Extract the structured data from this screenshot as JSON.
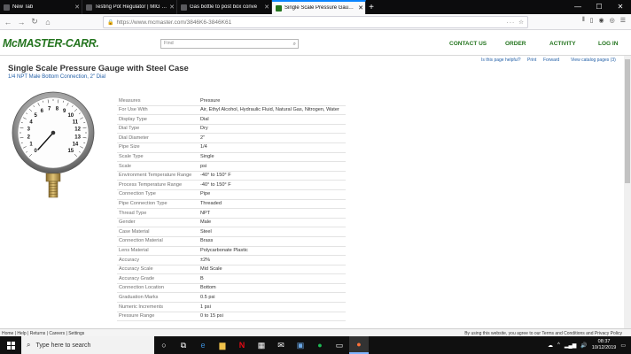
{
  "browser": {
    "tabs": [
      {
        "label": "New Tab",
        "active": false
      },
      {
        "label": "Testing Pot Regulator | MIG We",
        "active": false
      },
      {
        "label": "Gas bottle to post box conve",
        "active": false
      },
      {
        "label": "Single Scale Pressure Gauge w",
        "active": true
      }
    ],
    "url": "https://www.mcmaster.com/3846K6-3846K61"
  },
  "site": {
    "logo": "McMASTER-CARR.",
    "search_placeholder": "Find",
    "nav": [
      "CONTACT US",
      "ORDER",
      "ACTIVITY",
      "LOG IN"
    ],
    "subnav": {
      "helpful": "Is this page helpful?",
      "print": "Print",
      "forward": "Forward",
      "catalog": "View catalog pages (3)"
    }
  },
  "product": {
    "title": "Single Scale Pressure Gauge with Steel Case",
    "subtitle": "1/4 NPT Male Bottom Connection, 2\" Dial",
    "specs": [
      {
        "k": "Measures",
        "v": "Pressure"
      },
      {
        "k": "For Use With",
        "v": "Air, Ethyl Alcohol, Hydraulic Fluid, Natural Gas, Nitrogen, Water"
      },
      {
        "k": "Display Type",
        "v": "Dial"
      },
      {
        "k": "Dial Type",
        "v": "Dry"
      },
      {
        "k": "Dial Diameter",
        "v": "2\""
      },
      {
        "k": "Pipe Size",
        "v": "1/4"
      },
      {
        "k": "Scale Type",
        "v": "Single"
      },
      {
        "k": "Scale",
        "v": "psi"
      },
      {
        "k": "Environment Temperature Range",
        "v": "-40° to 150° F"
      },
      {
        "k": "Process Temperature Range",
        "v": "-40° to 150° F"
      },
      {
        "k": "Connection Type",
        "v": "Pipe"
      },
      {
        "k": "Pipe Connection Type",
        "v": "Threaded"
      },
      {
        "k": "Thread Type",
        "v": "NPT"
      },
      {
        "k": "Gender",
        "v": "Male"
      },
      {
        "k": "Case Material",
        "v": "Steel"
      },
      {
        "k": "Connection Material",
        "v": "Brass"
      },
      {
        "k": "Lens Material",
        "v": "Polycarbonate Plastic"
      },
      {
        "k": "Accuracy",
        "v": "±2%"
      },
      {
        "k": "Accuracy Scale",
        "v": "Mid Scale"
      },
      {
        "k": "Accuracy Grade",
        "v": "B"
      },
      {
        "k": "Connection Location",
        "v": "Bottom"
      },
      {
        "k": "Graduation Marks",
        "v": "0.5 psi"
      },
      {
        "k": "Numeric Increments",
        "v": "1 psi"
      },
      {
        "k": "Pressure Range",
        "v": "0 to 15 psi"
      }
    ],
    "gauge_numbers": [
      "0",
      "1",
      "2",
      "3",
      "4",
      "5",
      "6",
      "7",
      "8",
      "9",
      "10",
      "11",
      "12",
      "13",
      "14",
      "15"
    ]
  },
  "footer": {
    "left": "Home | Help | Returns | Careers | Settings",
    "right": "By using this website, you agree to our Terms and Conditions and Privacy Policy"
  },
  "taskbar": {
    "search_placeholder": "Type here to search",
    "time": "08:37",
    "date": "10/12/2019"
  }
}
